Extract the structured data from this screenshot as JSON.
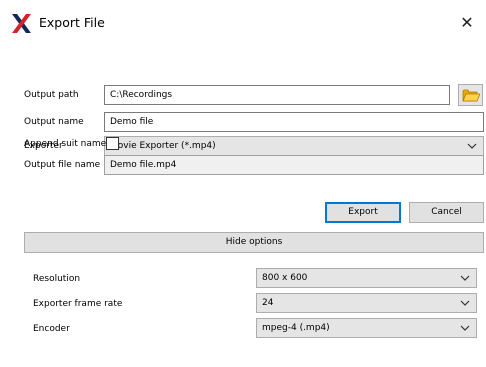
{
  "window": {
    "title": "Export File",
    "app_icon": "x-logo-icon",
    "close_glyph": "✕"
  },
  "form": {
    "output_path_label": "Output path",
    "output_path_value": "C:\\Recordings",
    "browse_icon": "folder-icon",
    "output_name_label": "Output name",
    "output_name_value": "Demo file",
    "exporter_label": "Exporter",
    "exporter_value": "Movie Exporter (*.mp4)",
    "append_suit_name_label": "Append suit name",
    "append_suit_name_checked": false,
    "output_file_name_label": "Output file name",
    "output_file_name_value": "Demo file.mp4"
  },
  "buttons": {
    "export": "Export",
    "cancel": "Cancel",
    "hide_options": "Hide options"
  },
  "options": {
    "resolution_label": "Resolution",
    "resolution_value": "800 x 600",
    "frame_rate_label": "Exporter frame rate",
    "frame_rate_value": "24",
    "encoder_label": "Encoder",
    "encoder_value": "mpeg-4 (.mp4)"
  },
  "colors": {
    "accent": "#0078d7",
    "logo": "#1a2a5a",
    "folder": "#f0b400"
  }
}
